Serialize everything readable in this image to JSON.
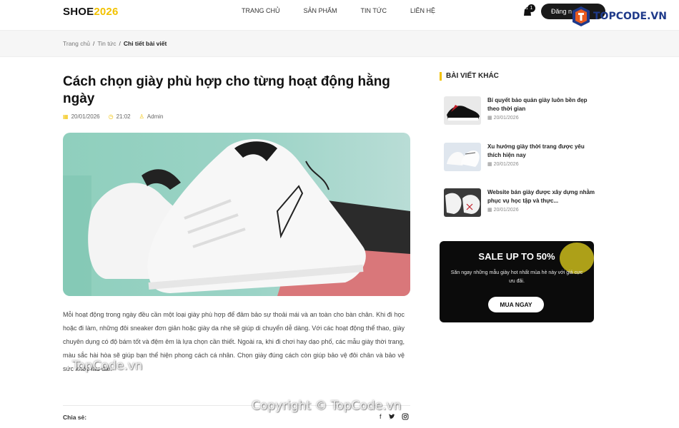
{
  "header": {
    "logo_a": "SHOE",
    "logo_b": "2026",
    "nav": [
      "TRANG CHỦ",
      "SẢN PHẨM",
      "TIN TỨC",
      "LIÊN HỆ"
    ],
    "cart_count": "1",
    "login_label": "Đăng n",
    "brand_logo": "TOPCODE.VN"
  },
  "breadcrumb": {
    "home": "Trang chủ",
    "news": "Tin tức",
    "current": "Chi tiết bài viết"
  },
  "article": {
    "title": "Cách chọn giày phù hợp cho từng hoạt động hằng ngày",
    "date": "20/01/2026",
    "time": "21:02",
    "author": "Admin",
    "body": "Mỗi hoạt động trong ngày đều cần một loại giày phù hợp để đảm bảo sự thoải mái và an toàn cho bàn chân. Khi đi học hoặc đi làm, những đôi sneaker đơn giản hoặc giày da nhẹ sẽ giúp di chuyển dễ dàng. Với các hoạt động thể thao, giày chuyên dụng có độ bám tốt và đệm êm là lựa chọn cần thiết. Ngoài ra, khi đi chơi hay dạo phố, các mẫu giày thời trang, màu sắc hài hòa sẽ giúp bạn thể hiện phong cách cá nhân. Chọn giày đúng cách còn giúp bảo vệ đôi chân và bảo vệ sức khỏe lâu dài.",
    "share_label": "Chia sẻ:"
  },
  "sidebar": {
    "title": "BÀI VIẾT KHÁC",
    "posts": [
      {
        "title": "Bí quyết bảo quản giày luôn bền đẹp theo thời gian",
        "date": "20/01/2026"
      },
      {
        "title": "Xu hướng giày thời trang được yêu thích hiện nay",
        "date": "20/01/2026"
      },
      {
        "title": "Website bán giày được xây dựng nhằm phục vụ học tập và thực...",
        "date": "20/01/2026"
      }
    ],
    "promo": {
      "heading": "SALE UP TO 50%",
      "text": "Săn ngay những mẫu giày hot nhất mùa hè này với giá cực ưu đãi.",
      "button": "MUA NGAY"
    }
  },
  "watermark": {
    "left": "TopCode.vn",
    "center": "Copyright © TopCode.vn"
  },
  "colors": {
    "accent": "#f2c200",
    "dark": "#0b0b0b"
  }
}
